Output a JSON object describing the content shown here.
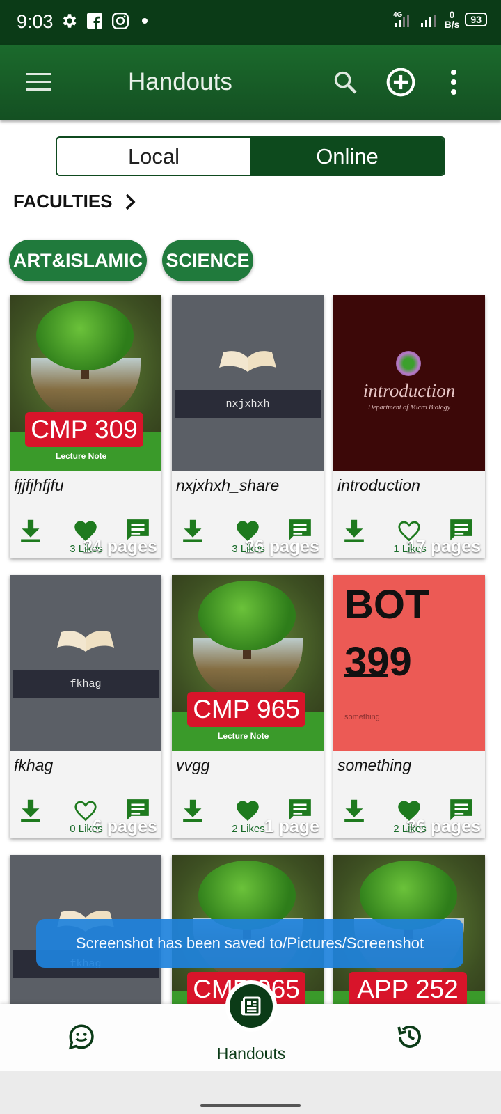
{
  "status_bar": {
    "time": "9:03",
    "network": "4G",
    "speed_value": "0",
    "speed_unit": "B/s",
    "battery": "93"
  },
  "app_bar": {
    "title": "Handouts",
    "menu_icon": "hamburger-menu-icon",
    "search_icon": "search-icon",
    "add_icon": "add-circle-icon",
    "more_icon": "more-vert-icon"
  },
  "toggle": {
    "local": "Local",
    "online": "Online",
    "selected": "Online"
  },
  "faculties": {
    "label": "FACULTIES"
  },
  "chips": [
    "ART&ISLAMIC",
    "SCIENCE"
  ],
  "cards": [
    {
      "title": "fjjfjhfjfu",
      "pages": "24  pages",
      "likes": "3 Likes",
      "liked": true,
      "cover": "tree",
      "course": "CMP 309",
      "cover_caption": "Lecture Note"
    },
    {
      "title": "nxjxhxh_share",
      "pages": "26  pages",
      "likes": "3 Likes",
      "liked": true,
      "cover": "book",
      "course": "nxjxhxh"
    },
    {
      "title": "introduction",
      "pages": "17  pages",
      "likes": "1 Likes",
      "liked": false,
      "cover": "intro",
      "course": "introduction",
      "cover_caption": "Department of Micro Biology"
    },
    {
      "title": "fkhag",
      "pages": "6  pages",
      "likes": "0 Likes",
      "liked": false,
      "cover": "book",
      "course": "fkhag"
    },
    {
      "title": "vvgg",
      "pages": "1  page",
      "likes": "2 Likes",
      "liked": true,
      "cover": "tree",
      "course": "CMP 965",
      "cover_caption": "Lecture Note"
    },
    {
      "title": "something",
      "pages": "36  pages",
      "likes": "2 Likes",
      "liked": true,
      "cover": "bot",
      "course": "BOT 399",
      "cover_caption": "something"
    }
  ],
  "partial_cards": [
    {
      "cover": "book",
      "course": "fkhag"
    },
    {
      "cover": "tree",
      "course": "CMP 965"
    },
    {
      "cover": "tree",
      "course": "APP 252"
    }
  ],
  "toast": {
    "text": "Screenshot has been saved to/Pictures/Screenshot"
  },
  "bottom_nav": {
    "left_icon": "chat-smile-icon",
    "center_icon": "handouts-icon",
    "center_label": "Handouts",
    "right_icon": "history-icon"
  },
  "colors": {
    "primary_dark": "#0b3b17",
    "primary": "#1b6a2c",
    "chip": "#207a3c",
    "action_green": "#1e7a1e",
    "toast": "#1e82dc"
  }
}
